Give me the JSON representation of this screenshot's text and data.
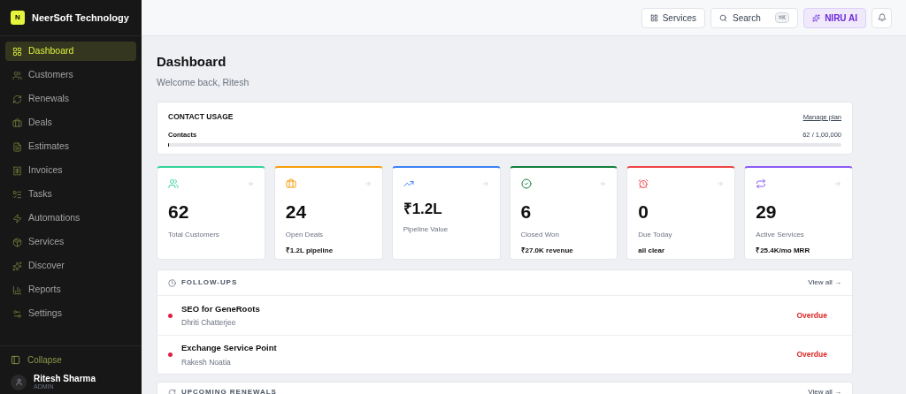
{
  "brand": {
    "logo": "N",
    "name": "NeerSoft Technology"
  },
  "sidebar": {
    "items": [
      {
        "label": "Dashboard",
        "selected": true
      },
      {
        "label": "Customers",
        "selected": false
      },
      {
        "label": "Renewals",
        "selected": false
      },
      {
        "label": "Deals",
        "selected": false
      },
      {
        "label": "Estimates",
        "selected": false
      },
      {
        "label": "Invoices",
        "selected": false
      },
      {
        "label": "Tasks",
        "selected": false
      },
      {
        "label": "Automations",
        "selected": false
      },
      {
        "label": "Services",
        "selected": false
      },
      {
        "label": "Discover",
        "selected": false
      },
      {
        "label": "Reports",
        "selected": false
      },
      {
        "label": "Settings",
        "selected": false
      }
    ],
    "collapse": "Collapse",
    "user": {
      "name": "Ritesh Sharma",
      "role": "ADMIN"
    }
  },
  "topbar": {
    "services": "Services",
    "search": "Search",
    "shortcut": "⌘K",
    "ai": "NIRU AI"
  },
  "page": {
    "title": "Dashboard",
    "subtitle": "Welcome back, Ritesh"
  },
  "usage": {
    "title": "CONTACT USAGE",
    "link": "Manage plan",
    "label": "Contacts",
    "reading": "62 / 1,00,000",
    "level": 0.0006
  },
  "stats": [
    {
      "value": "62",
      "label": "Total Customers",
      "color": "#34d399"
    },
    {
      "value": "24",
      "label": "Open Deals",
      "note": "₹1.2L pipeline",
      "color": "#f59e0b"
    },
    {
      "value": "₹1.2L",
      "label": "Pipeline Value",
      "color": "#3b82f6"
    },
    {
      "value": "6",
      "label": "Closed Won",
      "note": "₹27.0K revenue",
      "color": "#15803d"
    },
    {
      "value": "0",
      "label": "Due Today",
      "note": "all clear",
      "color": "#ef4444"
    },
    {
      "value": "29",
      "label": "Active Services",
      "note": "₹25.4K/mo MRR",
      "color": "#8b5cf6"
    }
  ],
  "followups": {
    "title": "FOLLOW-UPS",
    "link": "View all →",
    "items": [
      {
        "title": "SEO for GeneRoots",
        "person": "Dhriti Chatterjee",
        "status": "Overdue",
        "color": "#e11d48"
      },
      {
        "title": "Exchange Service Point",
        "person": "Rakesh Noatia",
        "status": "Overdue",
        "color": "#e11d48"
      }
    ]
  },
  "renewals": {
    "title": "UPCOMING RENEWALS",
    "link": "View all →"
  }
}
